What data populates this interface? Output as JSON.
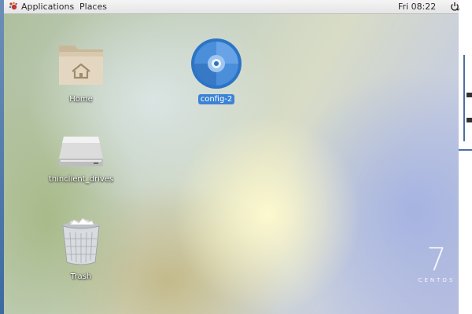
{
  "topbar": {
    "applications": "Applications",
    "places": "Places",
    "clock": "Fri 08:22",
    "power_icon": "power-icon",
    "apps_icon": "gnome-foot-icon"
  },
  "desktop": {
    "icons": [
      {
        "label": "Home",
        "icon": "home-folder-icon",
        "selected": false
      },
      {
        "label": "config-2",
        "icon": "optical-disc-icon",
        "selected": true
      },
      {
        "label": "thinclient_drives",
        "icon": "drive-icon",
        "selected": false
      },
      {
        "label": "Trash",
        "icon": "trash-icon",
        "selected": false
      }
    ],
    "watermark": {
      "number": "7",
      "word": "CENTOS"
    }
  },
  "colors": {
    "selection": "#3c83d5",
    "topbar": "#eeeeee"
  }
}
